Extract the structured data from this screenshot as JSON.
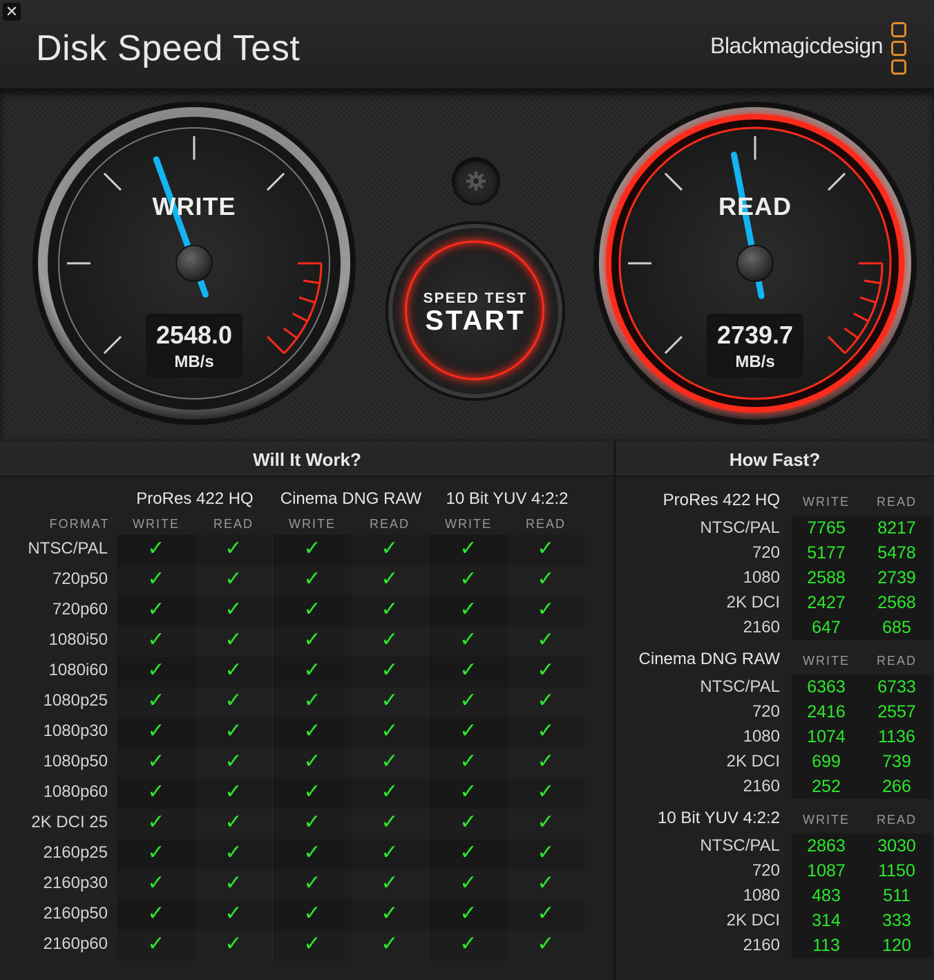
{
  "window": {
    "title": "Disk Speed Test",
    "brand": "Blackmagicdesign",
    "close_icon": "close-icon"
  },
  "gauges": {
    "write": {
      "label": "WRITE",
      "value": "2548.0",
      "unit": "MB/s",
      "needle_color": "#14b4f0"
    },
    "read": {
      "label": "READ",
      "value": "2739.7",
      "unit": "MB/s",
      "needle_color": "#14b4f0",
      "ring_color": "#ff2a1a"
    }
  },
  "start_button": {
    "sub_label": "SPEED TEST",
    "main_label": "START"
  },
  "settings_icon": "gear-icon",
  "will_it_work": {
    "title": "Will It Work?",
    "format_header": "FORMAT",
    "codecs": [
      "ProRes 422 HQ",
      "Cinema DNG RAW",
      "10 Bit YUV 4:2:2"
    ],
    "sub_headers": [
      "WRITE",
      "READ",
      "WRITE",
      "READ",
      "WRITE",
      "READ"
    ],
    "check_symbol": "✓",
    "formats": [
      "NTSC/PAL",
      "720p50",
      "720p60",
      "1080i50",
      "1080i60",
      "1080p25",
      "1080p30",
      "1080p50",
      "1080p60",
      "2K DCI 25",
      "2160p25",
      "2160p30",
      "2160p50",
      "2160p60"
    ]
  },
  "how_fast": {
    "title": "How Fast?",
    "write_header": "WRITE",
    "read_header": "READ",
    "sections": [
      {
        "name": "ProRes 422 HQ",
        "rows": [
          {
            "label": "NTSC/PAL",
            "write": "7765",
            "read": "8217"
          },
          {
            "label": "720",
            "write": "5177",
            "read": "5478"
          },
          {
            "label": "1080",
            "write": "2588",
            "read": "2739"
          },
          {
            "label": "2K DCI",
            "write": "2427",
            "read": "2568"
          },
          {
            "label": "2160",
            "write": "647",
            "read": "685"
          }
        ]
      },
      {
        "name": "Cinema DNG RAW",
        "rows": [
          {
            "label": "NTSC/PAL",
            "write": "6363",
            "read": "6733"
          },
          {
            "label": "720",
            "write": "2416",
            "read": "2557"
          },
          {
            "label": "1080",
            "write": "1074",
            "read": "1136"
          },
          {
            "label": "2K DCI",
            "write": "699",
            "read": "739"
          },
          {
            "label": "2160",
            "write": "252",
            "read": "266"
          }
        ]
      },
      {
        "name": "10 Bit YUV 4:2:2",
        "rows": [
          {
            "label": "NTSC/PAL",
            "write": "2863",
            "read": "3030"
          },
          {
            "label": "720",
            "write": "1087",
            "read": "1150"
          },
          {
            "label": "1080",
            "write": "483",
            "read": "511"
          },
          {
            "label": "2K DCI",
            "write": "314",
            "read": "333"
          },
          {
            "label": "2160",
            "write": "113",
            "read": "120"
          }
        ]
      }
    ]
  }
}
